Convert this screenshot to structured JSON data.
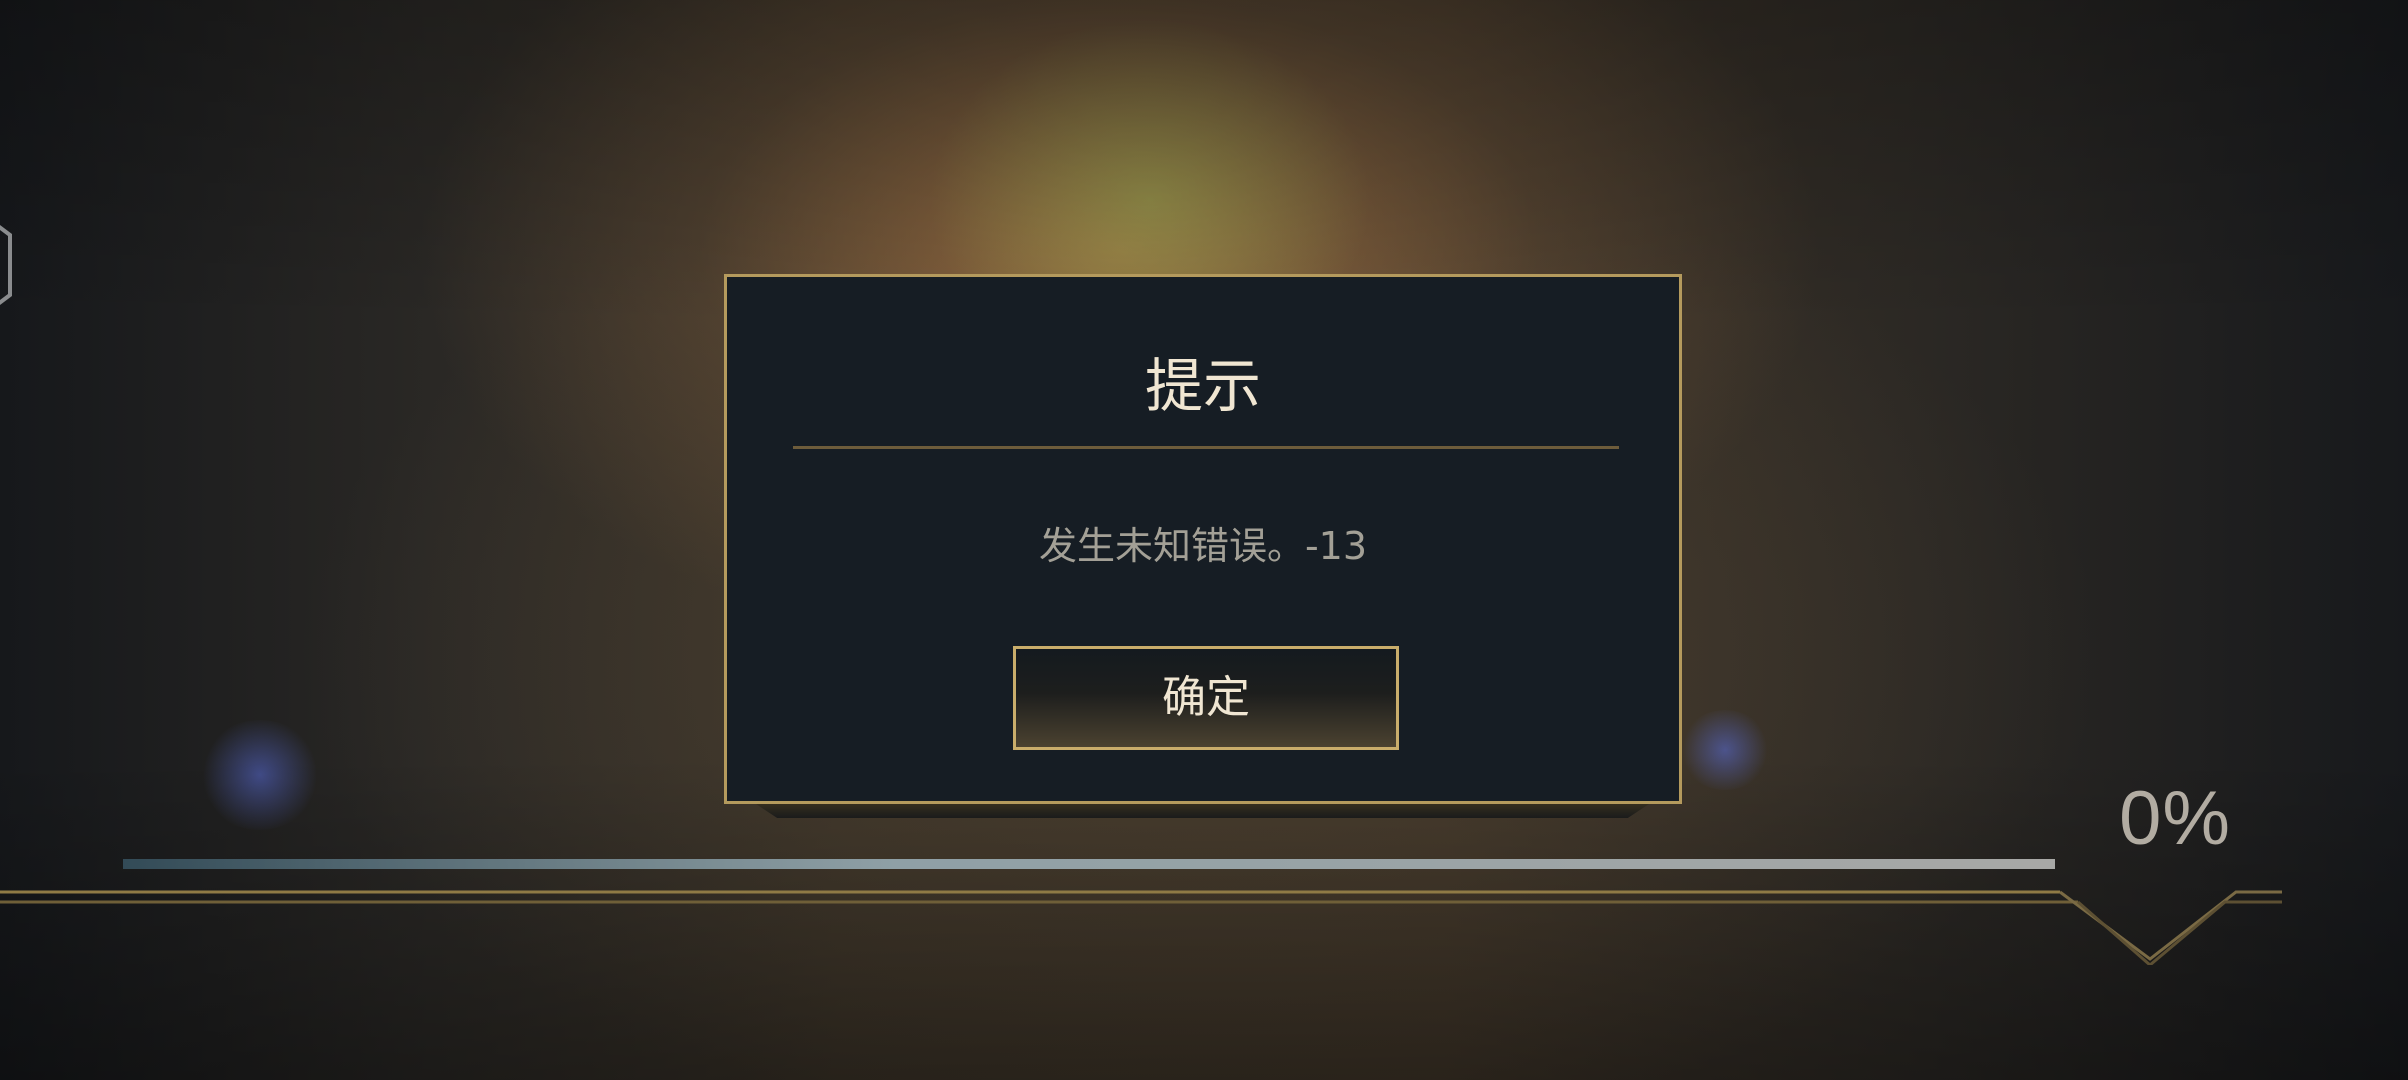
{
  "dialog": {
    "title": "提示",
    "message": "发生未知错误。-13",
    "confirm_label": "确定"
  },
  "loading": {
    "percent_text": "0%",
    "progress_fraction": 0
  },
  "colors": {
    "gold_border": "#b49a5d",
    "dialog_bg": "#161d24",
    "title_text": "#f0e6d2",
    "message_text": "#a3a096",
    "percent_text": "#b2aca2"
  }
}
